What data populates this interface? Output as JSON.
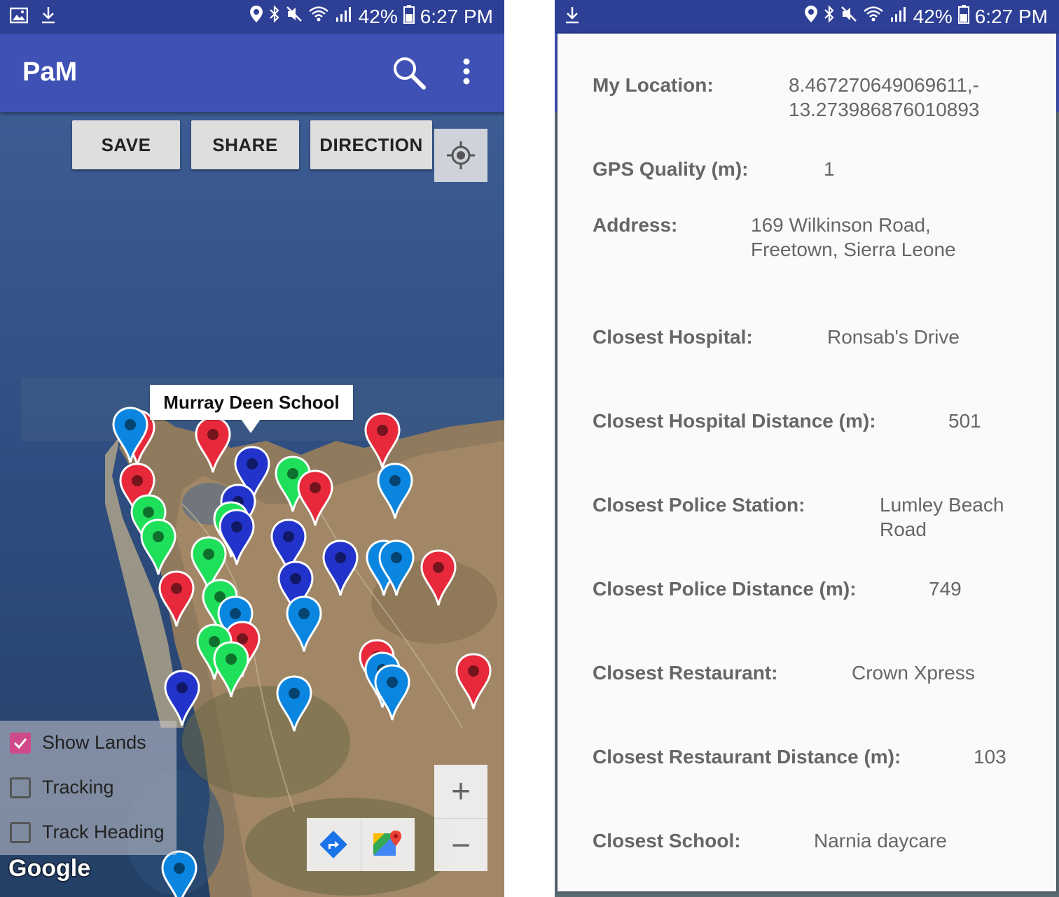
{
  "status_bar": {
    "battery": "42%",
    "time": "6:27 PM"
  },
  "app_bar": {
    "title": "PaM"
  },
  "map_buttons": {
    "save": "SAVE",
    "share": "SHARE",
    "direction": "DIRECTION"
  },
  "tooltip": {
    "text": "Murray Deen School"
  },
  "checkboxes": [
    {
      "label": "Show Lands",
      "checked": true
    },
    {
      "label": "Tracking",
      "checked": false
    },
    {
      "label": "Track Heading",
      "checked": false
    }
  ],
  "map_attribution": "Google",
  "zoom": {
    "in": "+",
    "out": "−"
  },
  "colors": {
    "primary": "#3f51b5",
    "status_bar": "#2e3f96",
    "pin_red": "#e8293b",
    "pin_green": "#1fe05a",
    "pin_blue": "#2233cc",
    "pin_azure": "#0a86e0"
  },
  "info": {
    "my_location_label": "My Location:",
    "my_location_line1": "8.467270649069611,-",
    "my_location_line2": "13.273986876010893",
    "gps_label": "GPS Quality (m):",
    "gps_value": "1",
    "address_label": "Address:",
    "address_line1": "169 Wilkinson Road,",
    "address_line2": "Freetown, Sierra Leone",
    "hospital_label": "Closest Hospital:",
    "hospital_value": "Ronsab's Drive",
    "hospital_dist_label": "Closest Hospital Distance (m):",
    "hospital_dist_value": "501",
    "police_label": "Closest Police Station:",
    "police_line1": "Lumley Beach",
    "police_line2": "Road",
    "police_dist_label": "Closest Police Distance (m):",
    "police_dist_value": "749",
    "restaurant_label": "Closest Restaurant:",
    "restaurant_value": "Crown Xpress",
    "restaurant_dist_label": "Closest Restaurant Distance (m):",
    "restaurant_dist_value": "103",
    "school_label": "Closest School:",
    "school_value": "Narnia daycare"
  }
}
